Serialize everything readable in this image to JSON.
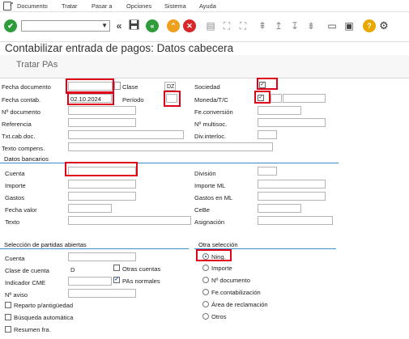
{
  "menu": {
    "doc_icon": "menu-icon",
    "items": [
      "Documento",
      "Tratar",
      "Pasar a",
      "Opciones",
      "Sistema",
      "Ayuda"
    ]
  },
  "toolbar": {
    "cmd_value": ""
  },
  "page": {
    "title": "Contabilizar entrada de pagos: Datos cabecera",
    "action": "Tratar PAs"
  },
  "header": {
    "fecha_doc_label": "Fecha documento",
    "fecha_doc_value": "",
    "clase_label": "Clase",
    "clase_value": "DZ",
    "sociedad_label": "Sociedad",
    "fecha_cont_label": "Fecha contab.",
    "fecha_cont_value": "02.10.2024",
    "periodo_label": "Período",
    "periodo_value": "",
    "moneda_label": "Moneda/T/C",
    "ndoc_label": "Nº documento",
    "fe_conv_label": "Fe.conversión",
    "referencia_label": "Referencia",
    "multisoc_label": "Nº multisoc.",
    "txtcab_label": "Txt.cab.doc.",
    "divinter_label": "Div.interloc.",
    "textocomp_label": "Texto compens."
  },
  "bank": {
    "title": "Datos bancarios",
    "cuenta_label": "Cuenta",
    "division_label": "División",
    "importe_label": "Importe",
    "importe_ml_label": "Importe ML",
    "gastos_label": "Gastos",
    "gastos_ml_label": "Gastos en ML",
    "fecha_valor_label": "Fecha valor",
    "cebe_label": "CeBe",
    "texto_label": "Texto",
    "asignacion_label": "Asignación"
  },
  "open_items": {
    "title": "Selección de partidas abiertas",
    "cuenta_label": "Cuenta",
    "clase_cuenta_label": "Clase de cuenta",
    "clase_cuenta_value": "D",
    "otras_cuentas_label": "Otras cuentas",
    "cme_label": "Indicador CME",
    "pas_normales_label": "PAs normales",
    "aviso_label": "Nº aviso",
    "reparto_label": "Reparto p/antigüedad",
    "busqueda_label": "Búsqueda automática",
    "resumen_label": "Resumen fra."
  },
  "other_sel": {
    "title": "Otra selección",
    "options": [
      "Ning.",
      "Importe",
      "Nº documento",
      "Fe.contabilización",
      "Área de reclamación",
      "Otros"
    ],
    "selected": "Ning."
  },
  "colors": {
    "accent_line": "#3a8fc8",
    "highlight": "#e0001a",
    "enter_green": "#2e9c3a",
    "nav_orange": "#f0a020",
    "cancel_red": "#d62828",
    "help_yellow": "#e8a800"
  }
}
